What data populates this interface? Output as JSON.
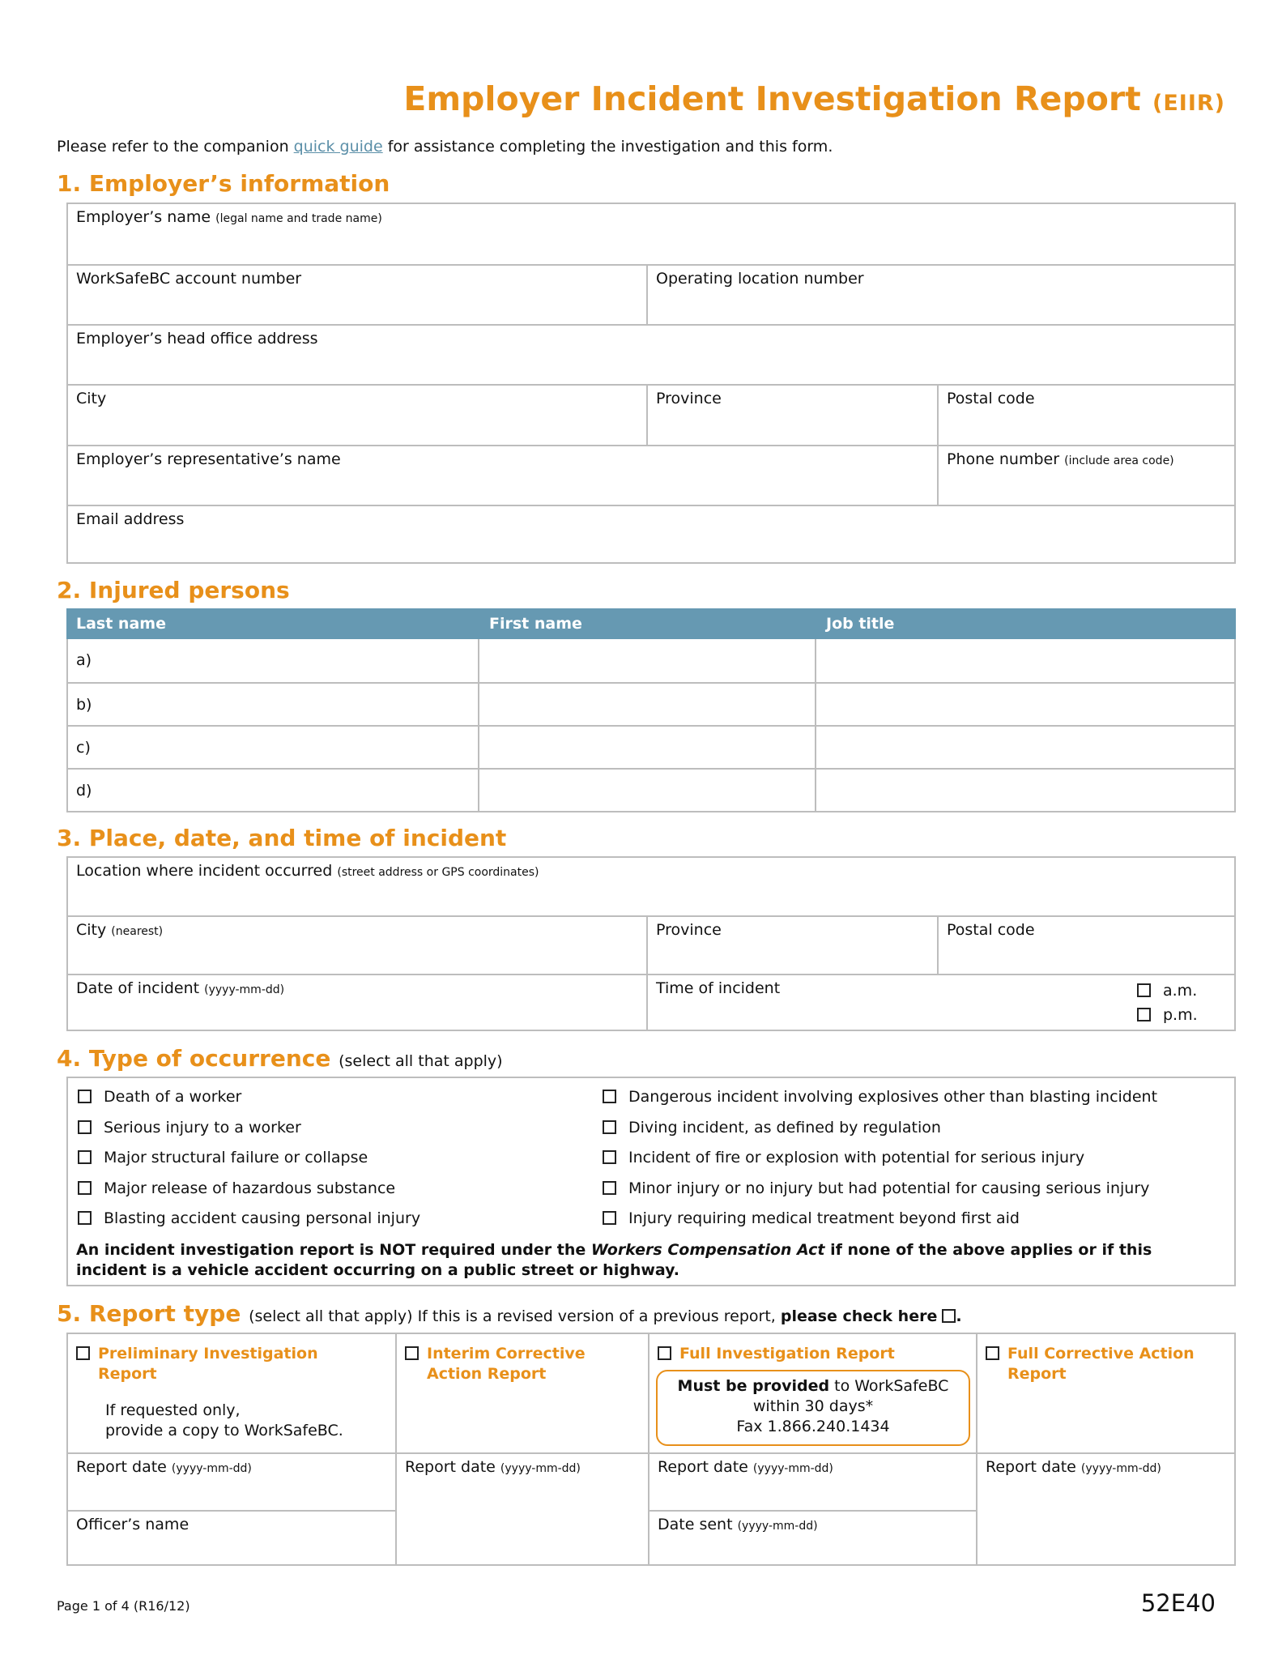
{
  "header": {
    "title": "Employer Incident Investigation Report",
    "acronym": "(EIIR)",
    "intro_before": "Please refer to the companion ",
    "intro_link": "quick guide",
    "intro_after": " for assistance completing the investigation and this form."
  },
  "colors": {
    "accent": "#e8901a",
    "table_header": "#6699b2",
    "link": "#5b8fa8",
    "border": "#bdbdbd"
  },
  "section1": {
    "title": "1.  Employer’s information",
    "fields": {
      "employer_name": "Employer’s name",
      "employer_name_hint": "(legal name and trade name)",
      "account_number": "WorkSafeBC account number",
      "operating_location": "Operating location number",
      "head_office": "Employer’s head office address",
      "city": "City",
      "province": "Province",
      "postal_code": "Postal code",
      "rep_name": "Employer’s representative’s name",
      "phone": "Phone number",
      "phone_hint": "(include area code)",
      "email": "Email address"
    }
  },
  "section2": {
    "title": "2.  Injured persons",
    "columns": [
      "Last name",
      "First name",
      "Job title"
    ],
    "rows": [
      "a)",
      "b)",
      "c)",
      "d)"
    ]
  },
  "section3": {
    "title": "3.  Place, date, and time of incident",
    "fields": {
      "location": "Location where incident occurred",
      "location_hint": "(street address or GPS coordinates)",
      "city": "City",
      "city_hint": "(nearest)",
      "province": "Province",
      "postal_code": "Postal code",
      "date": "Date of incident",
      "date_hint": "(yyyy-mm-dd)",
      "time": "Time of incident",
      "am": "a.m.",
      "pm": "p.m."
    }
  },
  "section4": {
    "title": "4.  Type of occurrence",
    "subtitle": "(select all that apply)",
    "left_options": [
      "Death of a worker",
      "Serious injury to a worker",
      "Major structural failure or collapse",
      "Major release of hazardous substance",
      "Blasting accident causing personal injury"
    ],
    "right_options": [
      "Dangerous incident involving explosives other than blasting incident",
      "Diving incident, as defined by regulation",
      "Incident of fire or explosion with potential for serious injury",
      "Minor injury or no injury but had potential for causing serious injury",
      "Injury requiring medical treatment beyond first aid"
    ],
    "note_before": "An incident investigation report is NOT required under the ",
    "note_act": "Workers Compensation Act",
    "note_after": " if none of the above applies or if this incident is a vehicle accident occurring on a public street or highway."
  },
  "section5": {
    "title": "5.  Report type",
    "subtitle": "(select all that apply) If this is a revised version of a previous report, ",
    "subtitle_bold": "please check here",
    "subtitle_end": ".",
    "types": [
      {
        "line1": "Preliminary Investigation",
        "line2": "Report"
      },
      {
        "line1": "Interim Corrective",
        "line2": "Action Report"
      },
      {
        "line1": "Full Investigation Report",
        "line2": ""
      },
      {
        "line1": "Full Corrective Action",
        "line2": "Report"
      }
    ],
    "prelim_note_1": "If requested only,",
    "prelim_note_2": "provide a copy to WorkSafeBC.",
    "callout_bold": "Must be provided",
    "callout_rest": " to WorkSafeBC",
    "callout_line2": "within 30 days*",
    "callout_line3": "Fax 1.866.240.1434",
    "report_date": "Report date",
    "date_hint": "(yyyy-mm-dd)",
    "officer_name": "Officer’s name",
    "date_sent": "Date sent"
  },
  "footer": {
    "page": "Page 1 of 4  (R16/12)",
    "form_code": "52E40"
  }
}
